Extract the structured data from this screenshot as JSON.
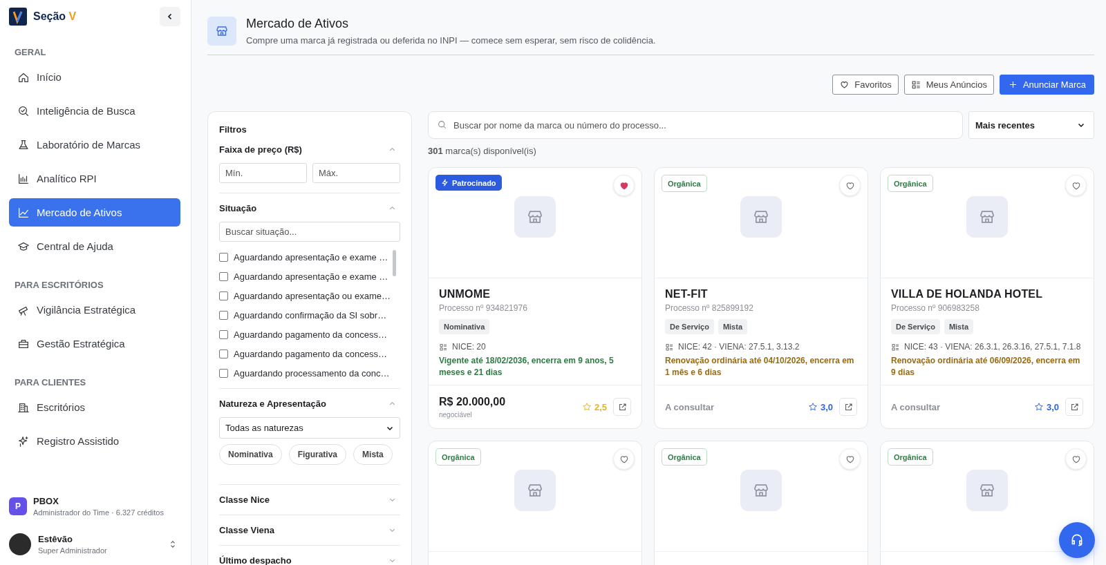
{
  "sidebar": {
    "brand": {
      "name": "Seção",
      "accent": "V"
    },
    "sections": [
      {
        "title": "GERAL",
        "items": [
          {
            "label": "Início",
            "selected": false
          },
          {
            "label": "Inteligência de Busca",
            "selected": false
          },
          {
            "label": "Laboratório de Marcas",
            "selected": false
          },
          {
            "label": "Analítico RPI",
            "selected": false
          },
          {
            "label": "Mercado de Ativos",
            "selected": true
          },
          {
            "label": "Central de Ajuda",
            "selected": false
          }
        ]
      },
      {
        "title": "PARA ESCRITÓRIOS",
        "items": [
          {
            "label": "Vigilância Estratégica",
            "selected": false
          },
          {
            "label": "Gestão Estratégica",
            "selected": false
          }
        ]
      },
      {
        "title": "PARA CLIENTES",
        "items": [
          {
            "label": "Escritórios",
            "selected": false
          },
          {
            "label": "Registro Assistido",
            "selected": false
          }
        ]
      }
    ],
    "team": {
      "initial": "P",
      "name": "PBOX",
      "subtitle": "Administrador do Time · 6.327 créditos"
    },
    "user": {
      "name": "Estêvão",
      "role": "Super Administrador"
    }
  },
  "header": {
    "title": "Mercado de Ativos",
    "subtitle": "Compre uma marca já registrada ou deferida no INPI — comece sem esperar, sem risco de colidência."
  },
  "actions": [
    {
      "label": "Favoritos",
      "kind": "outline"
    },
    {
      "label": "Meus Anúncios",
      "kind": "outline"
    },
    {
      "label": "Anunciar Marca",
      "kind": "primary"
    }
  ],
  "filters": {
    "title": "Filtros",
    "sections": [
      {
        "kind": "price",
        "title": "Faixa de preço (R$)",
        "expanded": true,
        "min_placeholder": "Mín.",
        "max_placeholder": "Máx."
      },
      {
        "kind": "checklist",
        "title": "Situação",
        "expanded": true,
        "search_placeholder": "Buscar situação...",
        "options": [
          {
            "label": "Aguardando apresentação e exame …",
            "checked": false
          },
          {
            "label": "Aguardando apresentação e exame …",
            "checked": false
          },
          {
            "label": "Aguardando apresentação ou exame…",
            "checked": false
          },
          {
            "label": "Aguardando confirmação da SI sobr…",
            "checked": false
          },
          {
            "label": "Aguardando pagamento da concess…",
            "checked": false
          },
          {
            "label": "Aguardando pagamento da concess…",
            "checked": false
          },
          {
            "label": "Aguardando processamento da conc…",
            "checked": false
          }
        ]
      },
      {
        "kind": "nature",
        "title": "Natureza e Apresentação",
        "expanded": true,
        "select_value": "Todas as naturezas",
        "chips": [
          {
            "label": "Nominativa",
            "selected": false
          },
          {
            "label": "Figurativa",
            "selected": false
          },
          {
            "label": "Mista",
            "selected": false
          }
        ]
      },
      {
        "title": "Classe Nice",
        "expanded": false
      },
      {
        "title": "Classe Viena",
        "expanded": false
      },
      {
        "title": "Último despacho",
        "expanded": false
      }
    ]
  },
  "search": {
    "placeholder": "Buscar por nome da marca ou número do processo...",
    "sort": "Mais recentes"
  },
  "count": "**301** marca(s) disponível(is)",
  "cards": [
    {
      "badge": {
        "kind": "sponsored",
        "label": "Patrocinado"
      },
      "favorite": true,
      "title": "UNMOME",
      "process": "Processo nº 934821976",
      "tags": [
        "Nominativa"
      ],
      "classes": "NICE: 20",
      "validity": {
        "text": "Vigente até 18/02/2036, encerra em 9 anos, 5 meses e 21 dias",
        "color": "#2f7d45"
      },
      "price": {
        "kind": "price",
        "text": "R$ 20.000,00",
        "note": "negociável"
      },
      "rating": {
        "value": "2,5",
        "color": "#e8b21f"
      }
    },
    {
      "badge": {
        "kind": "organic",
        "label": "Orgânica"
      },
      "favorite": false,
      "title": "NET-FIT",
      "process": "Processo nº 825899192",
      "tags": [
        "De Serviço",
        "Mista"
      ],
      "classes": "NICE: 42 · VIENA: 27.5.1, 3.13.2",
      "validity": {
        "text": "Renovação ordinária até 04/10/2026, encerra em 1 mês e 6 dias",
        "color": "#9a6b12"
      },
      "price": {
        "kind": "consult",
        "text": "A consultar"
      },
      "rating": {
        "value": "3,0",
        "color": "#2f64e0"
      }
    },
    {
      "badge": {
        "kind": "organic",
        "label": "Orgânica"
      },
      "favorite": false,
      "title": "VILLA DE HOLANDA HOTEL",
      "process": "Processo nº 906983258",
      "tags": [
        "De Serviço",
        "Mista"
      ],
      "classes": "NICE: 43 · VIENA: 26.3.1, 26.3.16, 27.5.1, 7.1.8",
      "validity": {
        "text": "Renovação ordinária até 06/09/2026, encerra em 9 dias",
        "color": "#9a6b12"
      },
      "price": {
        "kind": "consult",
        "text": "A consultar"
      },
      "rating": {
        "value": "3,0",
        "color": "#2f64e0"
      }
    },
    {
      "badge": {
        "kind": "organic",
        "label": "Orgânica"
      },
      "favorite": false
    },
    {
      "badge": {
        "kind": "organic",
        "label": "Orgânica"
      },
      "favorite": false
    },
    {
      "badge": {
        "kind": "organic",
        "label": "Orgânica"
      },
      "favorite": false
    }
  ]
}
